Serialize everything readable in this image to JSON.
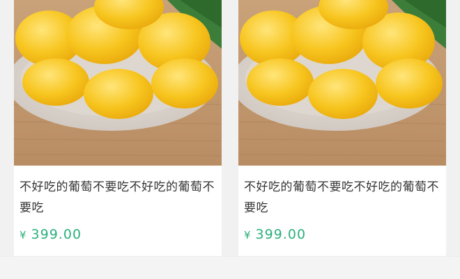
{
  "products": [
    {
      "image_icon": "mango-plate-photo",
      "title": "不好吃的葡萄不要吃不好吃的葡萄不要吃",
      "currency": "¥",
      "price": "399.00",
      "price_color": "#2bb07b"
    },
    {
      "image_icon": "mango-plate-photo",
      "title": "不好吃的葡萄不要吃不好吃的葡萄不要吃",
      "currency": "¥",
      "price": "399.00",
      "price_color": "#2bb07b"
    }
  ]
}
